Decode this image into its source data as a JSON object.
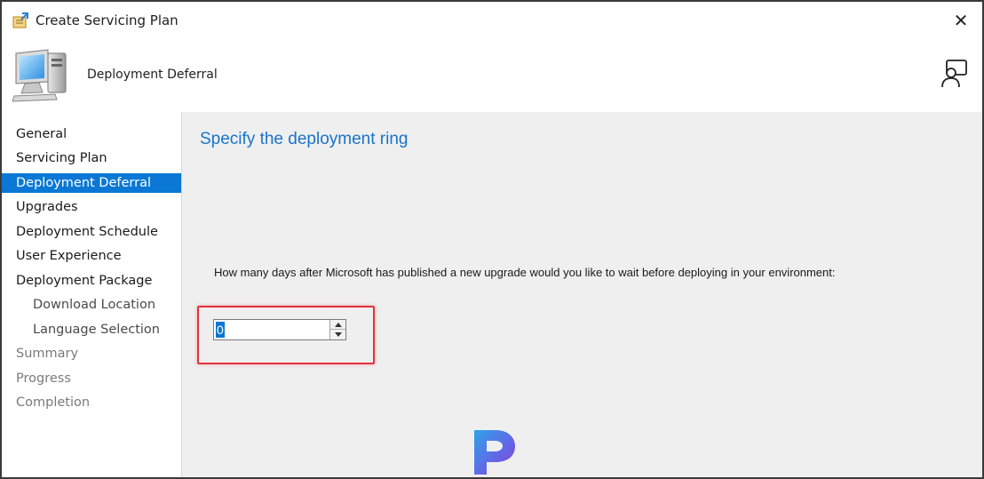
{
  "window": {
    "title": "Create Servicing Plan",
    "close_label": "✕"
  },
  "header": {
    "title": "Deployment Deferral",
    "icon": "computer-wizard-icon",
    "feedback_icon": "feedback-person-icon"
  },
  "sidebar": {
    "items": [
      {
        "label": "General",
        "state": "normal"
      },
      {
        "label": "Servicing Plan",
        "state": "normal"
      },
      {
        "label": "Deployment Deferral",
        "state": "active"
      },
      {
        "label": "Upgrades",
        "state": "normal"
      },
      {
        "label": "Deployment Schedule",
        "state": "normal"
      },
      {
        "label": "User Experience",
        "state": "normal"
      },
      {
        "label": "Deployment Package",
        "state": "normal"
      },
      {
        "label": "Download Location",
        "state": "sub"
      },
      {
        "label": "Language Selection",
        "state": "sub"
      },
      {
        "label": "Summary",
        "state": "disabled"
      },
      {
        "label": "Progress",
        "state": "disabled"
      },
      {
        "label": "Completion",
        "state": "disabled"
      }
    ]
  },
  "main": {
    "heading": "Specify the deployment ring",
    "question": "How many days after Microsoft has published a new upgrade would you like to wait before deploying in your environment:",
    "days_value": "0"
  },
  "colors": {
    "accent": "#0a78d4",
    "heading": "#1a73c9",
    "highlight": "#e2333b",
    "content_bg": "#efefef"
  }
}
